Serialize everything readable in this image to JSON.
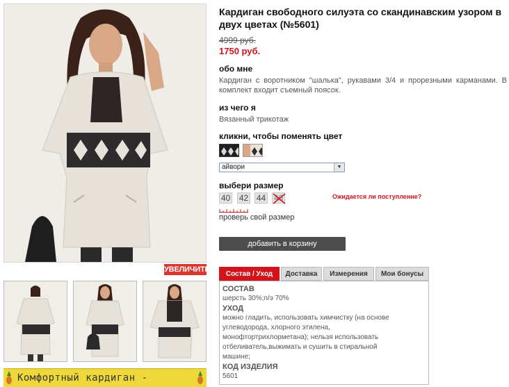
{
  "product": {
    "title": "Кардиган свободного силуэта со скандинавским узором в двух цветах (№5601)",
    "old_price": "4999 руб.",
    "new_price": "1750 руб."
  },
  "about": {
    "heading": "обо мне",
    "text": "Кардиган с воротником \"шалька\", рукавами 3/4 и прорезными карманами. В комплект входит съемный поясок."
  },
  "material": {
    "heading": "из чего я",
    "text": "Вязанный трикотаж"
  },
  "color": {
    "heading": "кликни, чтобы поменять цвет",
    "selected": "айвори",
    "swatches": [
      "black-pattern",
      "ivory-pattern"
    ]
  },
  "sizes": {
    "heading": "выбери размер",
    "items": [
      {
        "label": "40",
        "available": true
      },
      {
        "label": "42",
        "available": true
      },
      {
        "label": "44",
        "available": true
      },
      {
        "label": "46",
        "available": false
      }
    ],
    "expect_link": "Ожидается ли поступление?",
    "check_size": "проверь свой размер"
  },
  "cart_button": "добавить в корзину",
  "zoom_button": "УВЕЛИЧИТЬ",
  "banner_text": "Комфортный кардиган -",
  "tabs": [
    "Состав / Уход",
    "Доставка",
    "Измерения",
    "Мои бонусы"
  ],
  "panel": {
    "composition_heading": "СОСТАВ",
    "composition": "шерсть 30%;п/э 70%",
    "care_heading": "УХОД",
    "care_lines": [
      "можно гладить, использовать химчистку (на основе",
      "углеводорода, хлорного этилена,",
      "монофтортрихлорметана); нельзя использовать",
      "отбеливатель,выжимать и сушить в стиральной",
      "машине;"
    ],
    "code_heading": "КОД ИЗДЕЛИЯ",
    "code": "5601"
  },
  "colors": {
    "accent": "#d4141b",
    "button": "#4d4d4d",
    "banner": "#efd93a"
  }
}
